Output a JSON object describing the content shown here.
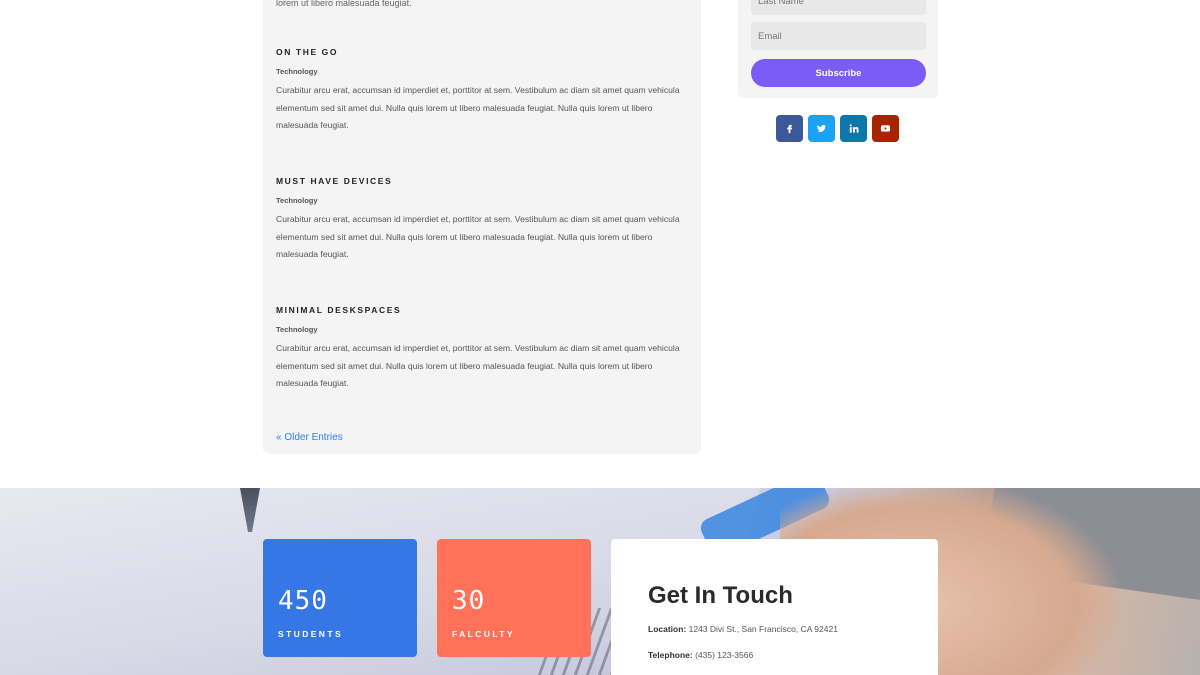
{
  "posts_section": {
    "cut_excerpt_end": "lorem ut libero malesuada feugiat.",
    "posts": [
      {
        "title": "ON THE GO",
        "category": "Technology",
        "excerpt": "Curabitur arcu erat, accumsan id imperdiet et, porttitor at sem. Vestibulum ac diam sit amet quam vehicula elementum sed sit amet dui. Nulla quis lorem ut libero malesuada feugiat. Nulla quis lorem ut libero malesuada feugiat."
      },
      {
        "title": "MUST HAVE DEVICES",
        "category": "Technology",
        "excerpt": "Curabitur arcu erat, accumsan id imperdiet et, porttitor at sem. Vestibulum ac diam sit amet quam vehicula elementum sed sit amet dui. Nulla quis lorem ut libero malesuada feugiat. Nulla quis lorem ut libero malesuada feugiat."
      },
      {
        "title": "MINIMAL DESKSPACES",
        "category": "Technology",
        "excerpt": "Curabitur arcu erat, accumsan id imperdiet et, porttitor at sem. Vestibulum ac diam sit amet quam vehicula elementum sed sit amet dui. Nulla quis lorem ut libero malesuada feugiat. Nulla quis lorem ut libero malesuada feugiat."
      }
    ],
    "older_entries": "« Older Entries"
  },
  "signup": {
    "last_name_placeholder": "Last Name",
    "email_placeholder": "Email",
    "subscribe_label": "Subscribe"
  },
  "socials": [
    {
      "name": "facebook-icon",
      "color": "#3b5998"
    },
    {
      "name": "twitter-icon",
      "color": "#1da1f2"
    },
    {
      "name": "linkedin-icon",
      "color": "#0e76a8"
    },
    {
      "name": "youtube-icon",
      "color": "#a82400"
    }
  ],
  "stats": [
    {
      "value": "450",
      "label": "STUDENTS",
      "color": "#3578e5"
    },
    {
      "value": "30",
      "label": "FALCULTY",
      "color": "#ff7158"
    }
  ],
  "contact": {
    "title": "Get In Touch",
    "location_label": "Location:",
    "location_value": "1243 Divi St., San Francisco, CA 92421",
    "telephone_label": "Telephone:",
    "telephone_value": "(435) 123-3566"
  },
  "colors": {
    "accent_purple": "#7c5cf6",
    "link_blue": "#2e7cf6"
  }
}
